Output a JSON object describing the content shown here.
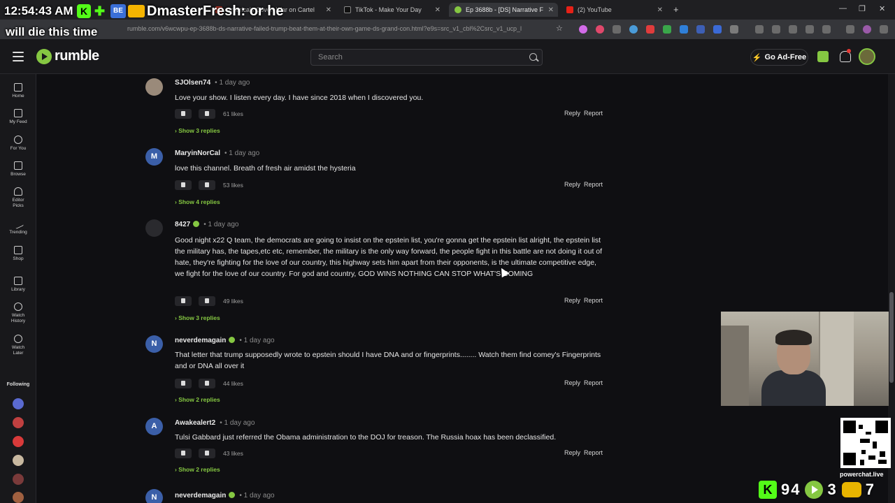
{
  "browser": {
    "tabs": [
      {
        "label": "America's Covert War on Cartel"
      },
      {
        "label": "TikTok - Make Your Day"
      },
      {
        "label": "Ep 3688b - [DS] Narrative F"
      },
      {
        "label": "(2) YouTube"
      }
    ],
    "url": "rumble.com/v6wcwpu-ep-3688b-ds-narrative-failed-trump-beat-them-at-their-own-game-ds-grand-con.html?e9s=src_v1_cbl%2Csrc_v1_ucp_l",
    "new_tab": "+"
  },
  "overlay": {
    "time": "12:54:43 AM",
    "chat_user": "DmasterFresh: or he",
    "chat_continued": "will die this time"
  },
  "header": {
    "logo": "rumble",
    "search_placeholder": "Search",
    "adfree_label": "Go Ad-Free"
  },
  "nav": {
    "items": [
      {
        "label": "Home"
      },
      {
        "label": "My Feed"
      },
      {
        "label": "For You"
      },
      {
        "label": "Browse"
      },
      {
        "label": "Editor Picks"
      },
      {
        "label": "Trending"
      },
      {
        "label": "Shop"
      },
      {
        "label": "Library"
      },
      {
        "label": "Watch History"
      },
      {
        "label": "Watch Later"
      }
    ],
    "following_label": "Following"
  },
  "comments": [
    {
      "user": "SJOlsen74",
      "time": "1 day ago",
      "text": "Love your show. I listen every day. I have since 2018 when I discovered you.",
      "likes": "61 likes",
      "show_replies": "› Show 3 replies",
      "avatar_letter": "",
      "avatar_color": "#9a8a7a",
      "verified": false
    },
    {
      "user": "MaryinNorCal",
      "time": "1 day ago",
      "text": "love this channel. Breath of fresh air amidst the hysteria",
      "likes": "53 likes",
      "show_replies": "› Show 4 replies",
      "avatar_letter": "M",
      "avatar_color": "#3b5fa8",
      "verified": false
    },
    {
      "user": "8427",
      "time": "1 day ago",
      "text": "Good night x22 Q team, the democrats are going to insist on the epstein list, you're gonna get the epstein list alright, the epstein list the military has, the tapes,etc etc, remember, the military is the only way forward, the people fight in this battle are not doing it out of hate, they're fighting for the love of our country, this highway sets him apart from their opponents, is the ultimate competitive edge, we fight for the love of our country. For god and country, GOD WINS NOTHING CAN STOP WHAT'S COMING",
      "likes": "49 likes",
      "show_replies": "› Show 3 replies",
      "avatar_letter": "",
      "avatar_color": "#2a2a2e",
      "verified": true
    },
    {
      "user": "neverdemagain",
      "time": "1 day ago",
      "text": "That letter that trump supposedly wrote to epstein should I have DNA and or fingerprints........ Watch them find comey's Fingerprints and or DNA all over it",
      "likes": "44 likes",
      "show_replies": "› Show 2 replies",
      "avatar_letter": "N",
      "avatar_color": "#3b5fa8",
      "verified": true
    },
    {
      "user": "Awakealert2",
      "time": "1 day ago",
      "text": "Tulsi Gabbard just referred the Obama administration to the DOJ for treason. The Russia hoax has been declassified.",
      "likes": "43 likes",
      "show_replies": "› Show 2 replies",
      "avatar_letter": "A",
      "avatar_color": "#3b5fa8",
      "verified": false
    },
    {
      "user": "neverdemagain",
      "time": "1 day ago",
      "text": "",
      "likes": "",
      "show_replies": "",
      "avatar_letter": "N",
      "avatar_color": "#3b5fa8",
      "verified": true
    }
  ],
  "action_labels": {
    "reply": "Reply",
    "report": "Report"
  },
  "stream_stats": {
    "kick_viewers": "94",
    "rumble_viewers": "3",
    "youtube_viewers": "7",
    "powerchat": "powerchat.live"
  }
}
